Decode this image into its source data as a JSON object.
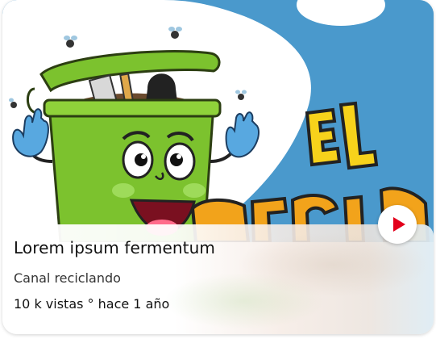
{
  "card": {
    "title": "Lorem ipsum fermentum",
    "channel": "Canal reciclando",
    "views": "10 k  vistas ° hace 1 año",
    "thumbnail_text": "EL RECICLA"
  },
  "icons": {
    "play": "play-icon"
  },
  "colors": {
    "accent": "#e3001b",
    "sky": "#4a99cc",
    "bin_green": "#7cc22e"
  }
}
